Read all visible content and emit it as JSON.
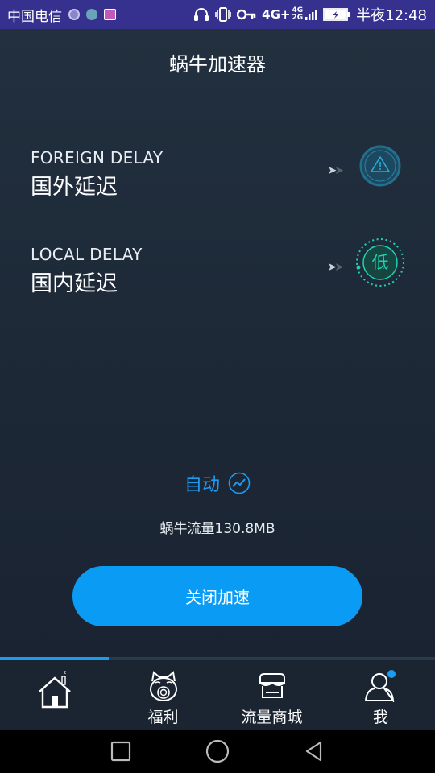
{
  "status_bar": {
    "carrier": "中国电信",
    "network_4g": "4G+",
    "network_4g_small": "4G",
    "network_2g": "2G",
    "time": "半夜12:48",
    "icons": [
      "circle-app-icon",
      "app-icon",
      "image-icon",
      "headphones-icon",
      "vibrate-icon",
      "key-icon",
      "signal-icon",
      "battery-charging-icon"
    ]
  },
  "header": {
    "title": "蜗牛加速器"
  },
  "delays": {
    "foreign": {
      "label_en": "FOREIGN DELAY",
      "label_cn": "国外延迟",
      "status_icon": "warning-icon"
    },
    "local": {
      "label_en": "LOCAL DELAY",
      "label_cn": "国内延迟",
      "status_text": "低"
    }
  },
  "mode": {
    "label": "自动",
    "icon": "trend-icon"
  },
  "traffic": {
    "text": "蜗牛流量130.8MB"
  },
  "main_button": {
    "label": "关闭加速"
  },
  "tab_progress": 0.25,
  "tabs": [
    {
      "label": "",
      "icon": "home-icon"
    },
    {
      "label": "福利",
      "icon": "lucky-cat-icon"
    },
    {
      "label": "流量商城",
      "icon": "shop-icon"
    },
    {
      "label": "我",
      "icon": "user-icon"
    }
  ],
  "nav": [
    "recent-apps-icon",
    "home-circle-icon",
    "back-icon"
  ],
  "colors": {
    "accent": "#0a9bf4",
    "status_bar": "#36318f",
    "teal": "#1fd1b3"
  }
}
